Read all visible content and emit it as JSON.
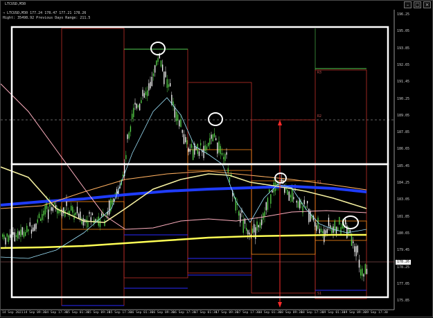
{
  "window": {
    "symbol_label": "LTCUSD,M30",
    "ohlc_line": "→ LTCUSD,M30  177.24 178.47 177.21 178.26",
    "info_line": "Hight: 35498.92    Previous Days Range: 211.5",
    "controls": [
      "–",
      "□",
      "×"
    ]
  },
  "price_axis": {
    "ticks": [
      "196.25",
      "195.05",
      "193.85",
      "192.65",
      "191.45",
      "190.25",
      "189.05",
      "187.85",
      "186.65",
      "185.45",
      "184.25",
      "183.05",
      "181.85",
      "180.65",
      "179.45",
      "178.25",
      "177.05",
      "175.85"
    ],
    "current_price": "178.26"
  },
  "time_axis": {
    "ticks": [
      "14 Sep 2021",
      "14 Sep 09:30",
      "14 Sep 17:30",
      "15 Sep 01:30",
      "15 Sep 09:30",
      "15 Sep 17:30",
      "16 Sep 01:30",
      "16 Sep 09:30",
      "16 Sep 17:30",
      "17 Sep 01:30",
      "17 Sep 09:30",
      "17 Sep 17:30",
      "18 Sep 01:30",
      "18 Sep 09:30",
      "18 Sep 17:30",
      "19 Sep 01:30",
      "19 Sep 09:30",
      "19 Sep 17:30"
    ]
  },
  "pivot_labels": [
    "R3",
    "R2",
    "R1",
    "S1"
  ],
  "colors": {
    "background": "#000000",
    "bull_candle": "#58d84a",
    "bear_candle": "#ffffff",
    "ma_blue": "#1f3cff",
    "ma_yellow": "#ffff55",
    "ma_pale_yellow": "#f5f0a0",
    "ma_orange": "#ffb060",
    "ma_pink": "#ffb0c0",
    "bollinger": "#9fe6ff",
    "box_red": "#c0302a",
    "box_orange": "#ff8c1a",
    "box_blue": "#2a2aff",
    "box_green": "#55d055",
    "arrow_red": "#ff2a2a",
    "annotation_white": "#ffffff"
  }
}
